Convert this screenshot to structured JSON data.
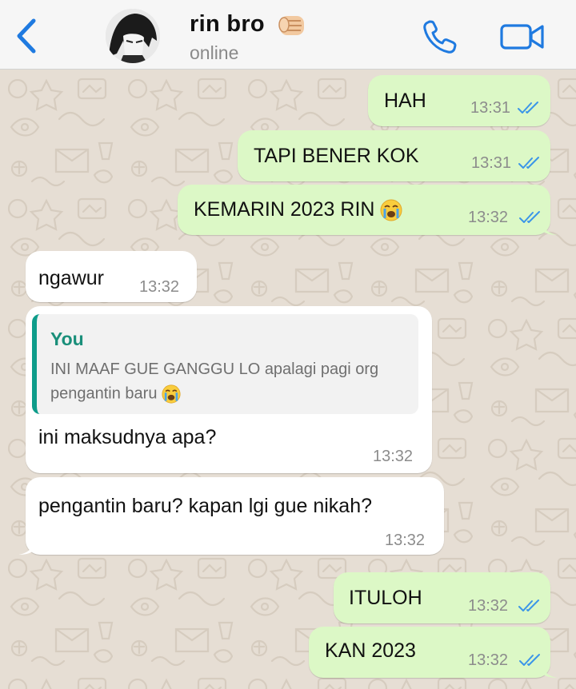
{
  "header": {
    "contact_name": "rin bro",
    "status": "online",
    "name_emoji": "fist-emoji"
  },
  "icons": {
    "back": "chevron-left-icon",
    "call": "phone-icon",
    "video": "video-camera-icon",
    "read_receipt": "double-check-icon",
    "crying_emoji": "loudly-crying-face-emoji"
  },
  "colors": {
    "accent": "#1f7ae0",
    "outgoing_bubble": "#dcf8c6",
    "incoming_bubble": "#ffffff",
    "quote_bar": "#0e9c8a",
    "read_ticks": "#3b95e8",
    "chat_background": "#e6ded4"
  },
  "messages": [
    {
      "direction": "out",
      "text": "HAH",
      "time": "13:31",
      "read": true
    },
    {
      "direction": "out",
      "text": "TAPI BENER KOK",
      "time": "13:31",
      "read": true
    },
    {
      "direction": "out",
      "text": "KEMARIN 2023 RIN",
      "emoji": "loudly-crying-face-emoji",
      "time": "13:32",
      "read": true
    },
    {
      "direction": "in",
      "text": "ngawur",
      "time": "13:32"
    },
    {
      "direction": "in",
      "text": "ini maksudnya apa?",
      "time": "13:32",
      "quote": {
        "author": "You",
        "line1": "INI MAAF GUE GANGGU LO apalagi pagi org",
        "line2": "pengantin baru",
        "emoji": "loudly-crying-face-emoji"
      }
    },
    {
      "direction": "in",
      "text": "pengantin baru? kapan lgi gue nikah?",
      "time": "13:32"
    },
    {
      "direction": "out",
      "text": "ITULOH",
      "time": "13:32",
      "read": true
    },
    {
      "direction": "out",
      "text": "KAN 2023",
      "time": "13:32",
      "read": true
    }
  ]
}
